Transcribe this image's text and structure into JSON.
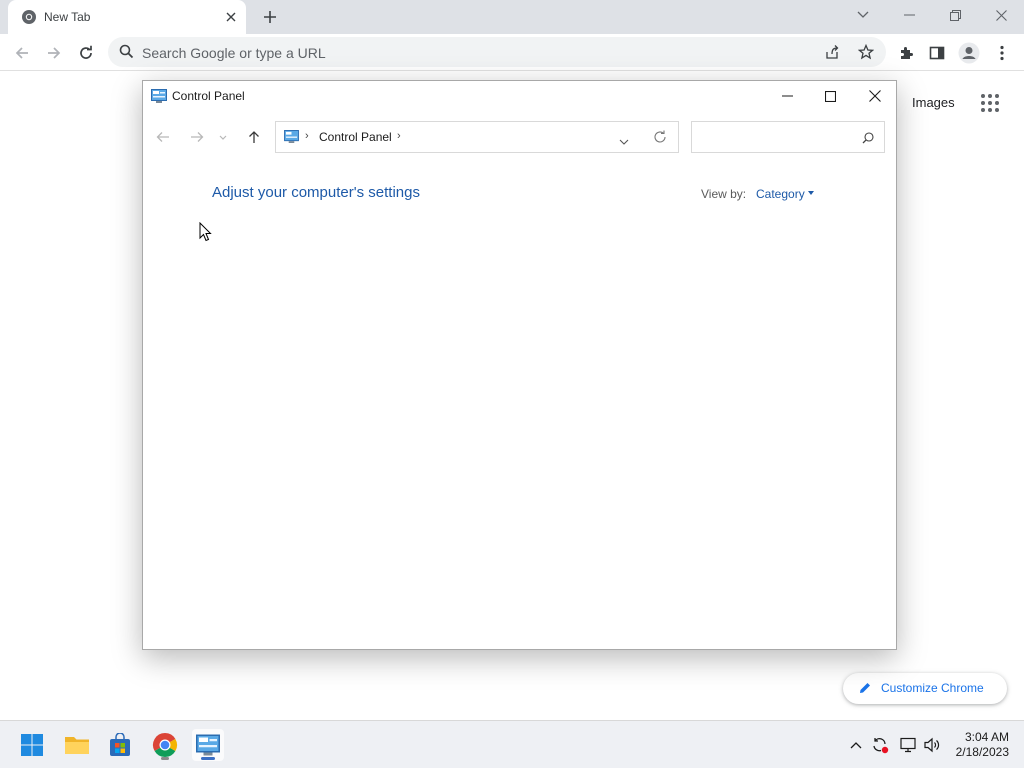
{
  "browser": {
    "tab_title": "New Tab",
    "omnibox_placeholder": "Search Google or type a URL",
    "images_link": "Images",
    "customize_label": "Customize Chrome"
  },
  "control_panel": {
    "window_title": "Control Panel",
    "breadcrumb": "Control Panel",
    "breadcrumb_sep": "›",
    "heading": "Adjust your computer's settings",
    "view_by_label": "View by:",
    "view_by_value": "Category",
    "search_placeholder": ""
  },
  "taskbar": {
    "time": "3:04 AM",
    "date": "2/18/2023",
    "pinned": [
      "start",
      "file-explorer",
      "microsoft-store",
      "chrome",
      "control-panel"
    ]
  },
  "colors": {
    "chrome_accent": "#1a73e8",
    "cp_link": "#1e5aa8",
    "tabstrip_bg": "#dee1e6"
  }
}
